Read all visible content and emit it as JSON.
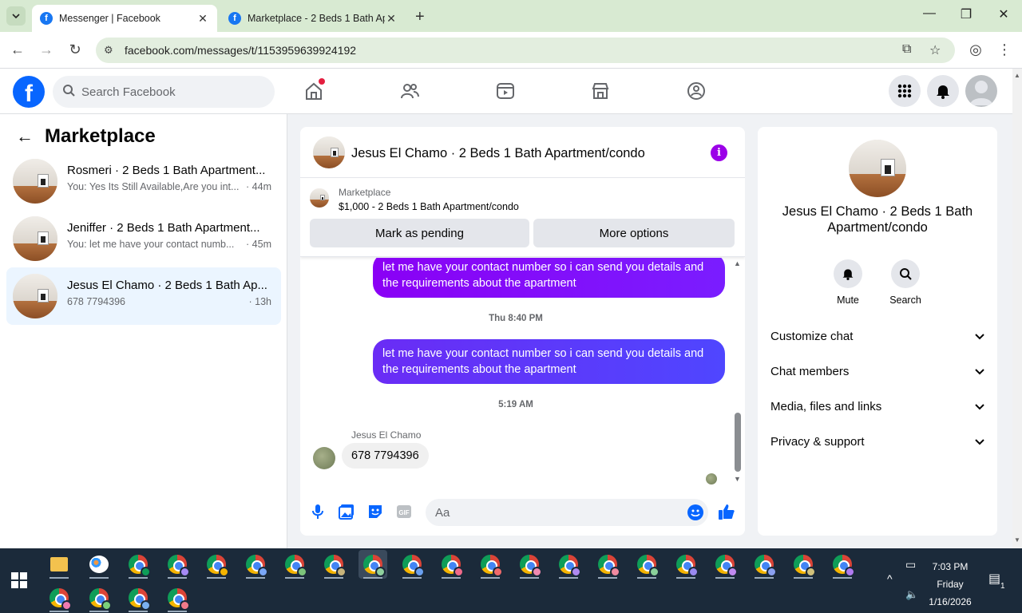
{
  "browser": {
    "tabs": [
      {
        "title": "Messenger | Facebook",
        "active": true
      },
      {
        "title": "Marketplace - 2 Beds 1 Bath Ap",
        "active": false
      }
    ],
    "url": "facebook.com/messages/t/1153959639924192"
  },
  "fb": {
    "search_placeholder": "Search Facebook",
    "nav_icons": [
      "home-icon",
      "friends-icon",
      "video-icon",
      "marketplace-icon",
      "groups-icon"
    ],
    "right_icons": [
      "menu-grid-icon",
      "bell-icon",
      "account-avatar"
    ]
  },
  "left": {
    "title": "Marketplace",
    "conversations": [
      {
        "name": "Rosmeri · 2 Beds 1 Bath Apartment...",
        "preview": "You: Yes Its Still Available,Are you int...",
        "time": "· 44m"
      },
      {
        "name": "Jeniffer · 2 Beds 1 Bath Apartment...",
        "preview": "You: let me have your contact numb...",
        "time": "· 45m"
      },
      {
        "name": "Jesus El Chamo · 2 Beds 1 Bath Ap...",
        "preview": "678 7794396",
        "time": "· 13h"
      }
    ]
  },
  "chat": {
    "title": "Jesus El Chamo · 2 Beds 1 Bath Apartment/condo",
    "listing_source": "Marketplace",
    "listing_price": "$1,000 - 2 Beds 1 Bath Apartment/condo",
    "btn_pending": "Mark as pending",
    "btn_more": "More options",
    "msg1": "let me have your contact number so i can send you details and the requirements about the apartment",
    "ts1": "Thu 8:40 PM",
    "msg2": "let me have your contact number so i can send you details and the requirements about the apartment",
    "ts2": "5:19 AM",
    "sender": "Jesus El Chamo",
    "incoming": "678 7794396",
    "composer_placeholder": "Aa"
  },
  "right": {
    "name": "Jesus El Chamo · 2 Beds 1 Bath Apartment/condo",
    "mute": "Mute",
    "search": "Search",
    "sections": [
      "Customize chat",
      "Chat members",
      "Media, files and links",
      "Privacy & support"
    ]
  },
  "taskbar": {
    "time": "7:03 PM",
    "day": "Friday",
    "date": "1/16/2026",
    "notif_count": "1"
  },
  "colors": {
    "fb_blue": "#0866ff",
    "bubble_purple": "#8a00f5",
    "bubble_indigo": "#4f46ff"
  }
}
